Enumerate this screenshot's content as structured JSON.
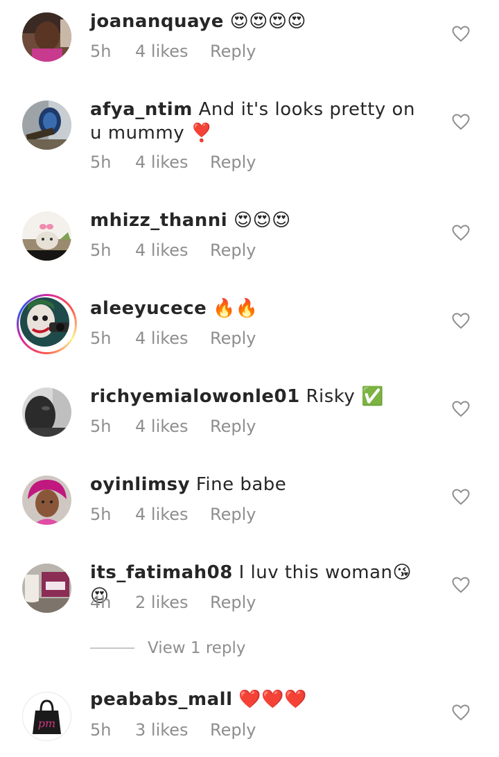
{
  "comments": [
    {
      "username": "joananquaye",
      "text": "😍😍😍😍",
      "time": "5h",
      "likes": "4 likes",
      "reply": "Reply"
    },
    {
      "username": "afya_ntim",
      "text": "And it's looks pretty on u mummy ❣️",
      "time": "5h",
      "likes": "4 likes",
      "reply": "Reply"
    },
    {
      "username": "mhizz_thanni",
      "text": "😍😍😍",
      "time": "5h",
      "likes": "4 likes",
      "reply": "Reply"
    },
    {
      "username": "aleeyucece",
      "text": "🔥🔥",
      "time": "5h",
      "likes": "4 likes",
      "reply": "Reply"
    },
    {
      "username": "richyemialowonle01",
      "text": "Risky ✅",
      "time": "5h",
      "likes": "4 likes",
      "reply": "Reply"
    },
    {
      "username": "oyinlimsy",
      "text": "Fine babe",
      "time": "5h",
      "likes": "4 likes",
      "reply": "Reply"
    },
    {
      "username": "its_fatimah08",
      "text": "I luv this woman😘😍",
      "time": "4h",
      "likes": "2 likes",
      "reply": "Reply"
    },
    {
      "username": "peababs_mall",
      "text": "❤️❤️❤️",
      "time": "5h",
      "likes": "3 likes",
      "reply": "Reply"
    }
  ],
  "view_replies": "View 1 reply",
  "avatar_logo_text": "pm",
  "colors": {
    "text": "#262626",
    "muted": "#8e8e8e",
    "divider": "#c7c7c7"
  }
}
